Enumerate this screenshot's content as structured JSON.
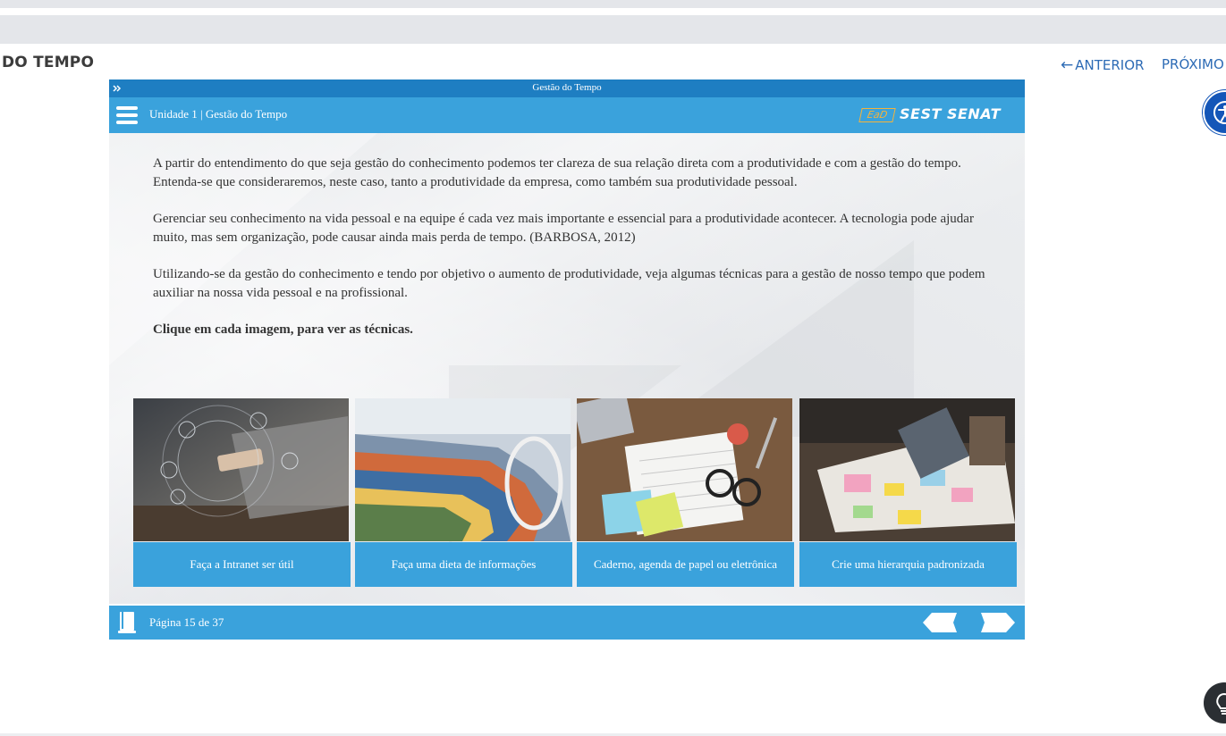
{
  "page": {
    "course_title": "DO TEMPO",
    "nav_prev_label": "ANTERIOR",
    "nav_next_label": "PRÓXIMO"
  },
  "player": {
    "window_title": "Gestão do Tempo",
    "unit_title": "Unidade 1 | Gestão do Tempo",
    "brand": {
      "badge": "EaD",
      "name": "SEST SENAT"
    },
    "paragraphs": [
      "A partir do entendimento do que seja gestão do conhecimento podemos ter clareza de sua relação direta com a produtividade e com a gestão do tempo. Entenda-se que consideraremos, neste caso, tanto a produtividade da empresa, como também sua produtividade pessoal.",
      "Gerenciar seu conhecimento na vida pessoal e na equipe é cada vez mais importante e essencial para a produtividade acontecer. A tecnologia pode ajudar muito, mas sem organização, pode causar ainda mais perda de tempo. (BARBOSA, 2012)",
      "Utilizando-se da gestão do conhecimento e tendo por objetivo o aumento de produtividade, veja algumas técnicas para a gestão de nosso tempo que podem auxiliar na nossa vida pessoal e na profissional."
    ],
    "call_to_action": "Clique em cada imagem, para ver as técnicas.",
    "cards": [
      {
        "label": "Faça a Intranet ser útil",
        "image": "laptop-network-photo"
      },
      {
        "label": "Faça uma dieta de informações",
        "image": "magazines-stack-photo"
      },
      {
        "label": "Caderno, agenda de papel ou eletrônica",
        "image": "desk-calendar-photo"
      },
      {
        "label": "Crie uma hierarquia padronizada",
        "image": "team-documents-photo"
      }
    ],
    "footer": {
      "page_counter": "Página 15 de 37"
    }
  },
  "colors": {
    "title_bar": "#1e7ec2",
    "header_blue": "#3aa2dc",
    "link_blue": "#2d6bb5",
    "accessibility_blue": "#1456b8",
    "brand_orange": "#f5b33a"
  },
  "icons": {
    "expand": "double-chevron-right-icon",
    "menu": "hamburger-menu-icon",
    "book": "book-icon",
    "prev": "arrow-left-icon",
    "next": "arrow-right-icon",
    "accessibility": "accessibility-icon",
    "tip": "lightbulb-icon"
  }
}
